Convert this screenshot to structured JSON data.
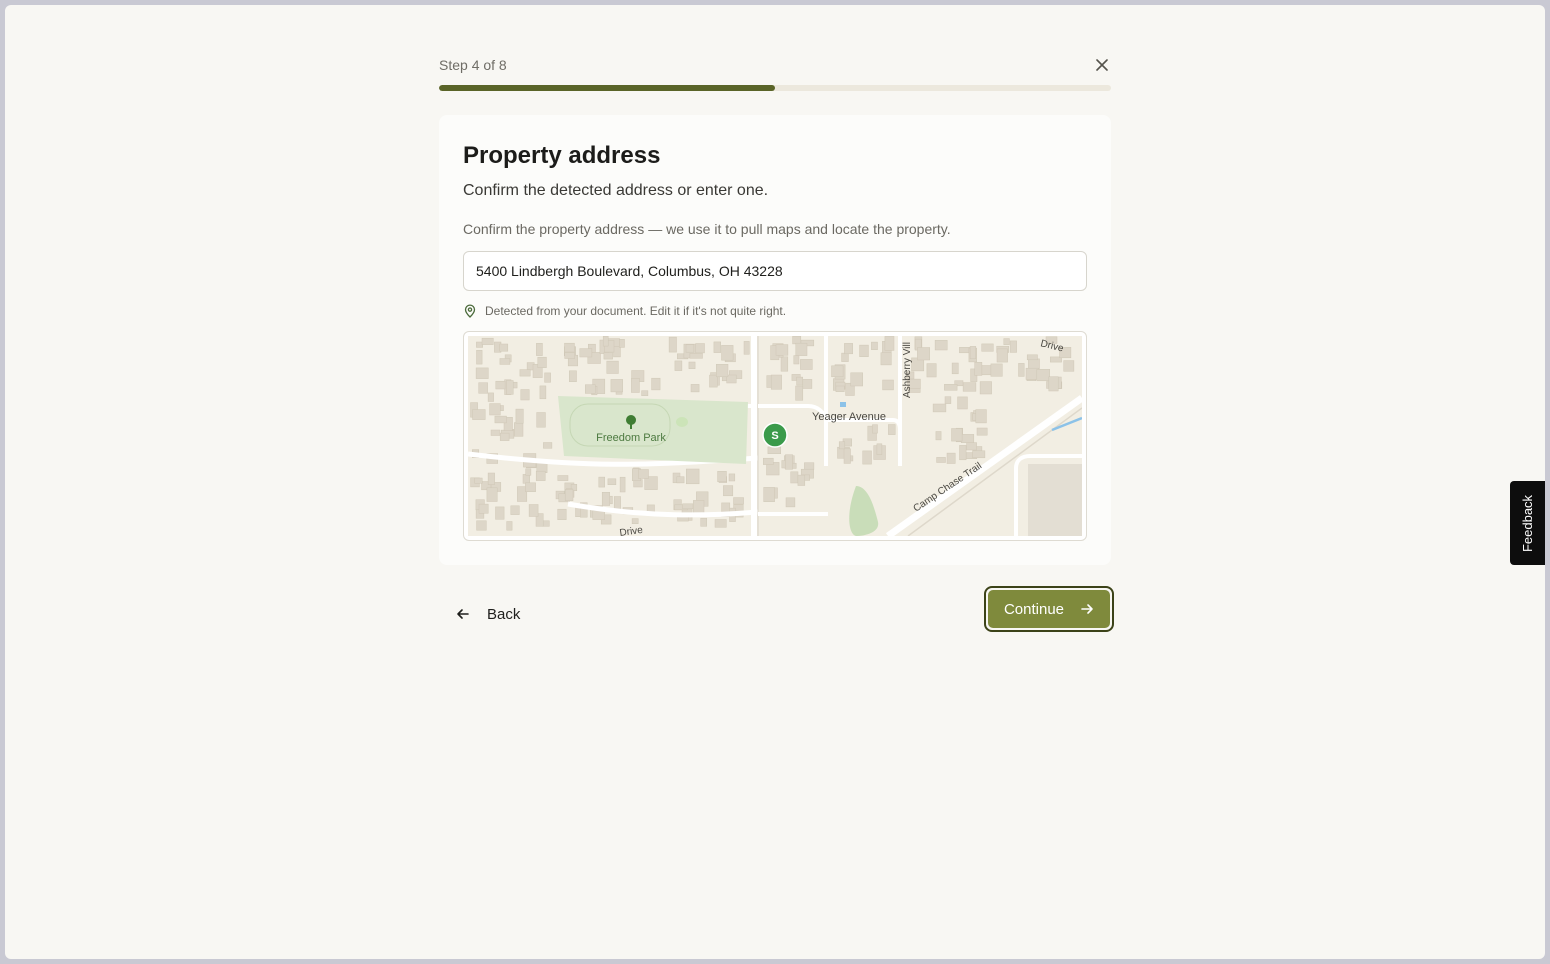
{
  "step": {
    "label": "Step 4 of 8",
    "current": 4,
    "total": 8,
    "progress_fraction": 0.5
  },
  "card": {
    "title": "Property address",
    "subtitle": "Confirm the detected address or enter one.",
    "help": "Confirm the property address — we use it to pull maps and locate the property.",
    "address_value": "5400 Lindbergh Boulevard, Columbus, OH 43228",
    "detected_note": "Detected from your document. Edit it if it's not quite right."
  },
  "map": {
    "labels": {
      "park": "Freedom Park",
      "street1": "Yeager Avenue",
      "street2": "Ashberry Vill",
      "street3": "Camp Chase Trail",
      "street4": "Drive",
      "street5": "Drive"
    },
    "marker_letter": "S",
    "marker_color": "#3a9a4a"
  },
  "nav": {
    "back_label": "Back",
    "continue_label": "Continue"
  },
  "feedback": {
    "label": "Feedback"
  },
  "colors": {
    "accent": "#7f8a3c",
    "progress": "#5a6428",
    "background": "#f8f7f3"
  },
  "icons": {
    "close": "close-icon",
    "pin": "map-pin-icon",
    "back": "arrow-left-icon",
    "forward": "arrow-right-icon"
  }
}
